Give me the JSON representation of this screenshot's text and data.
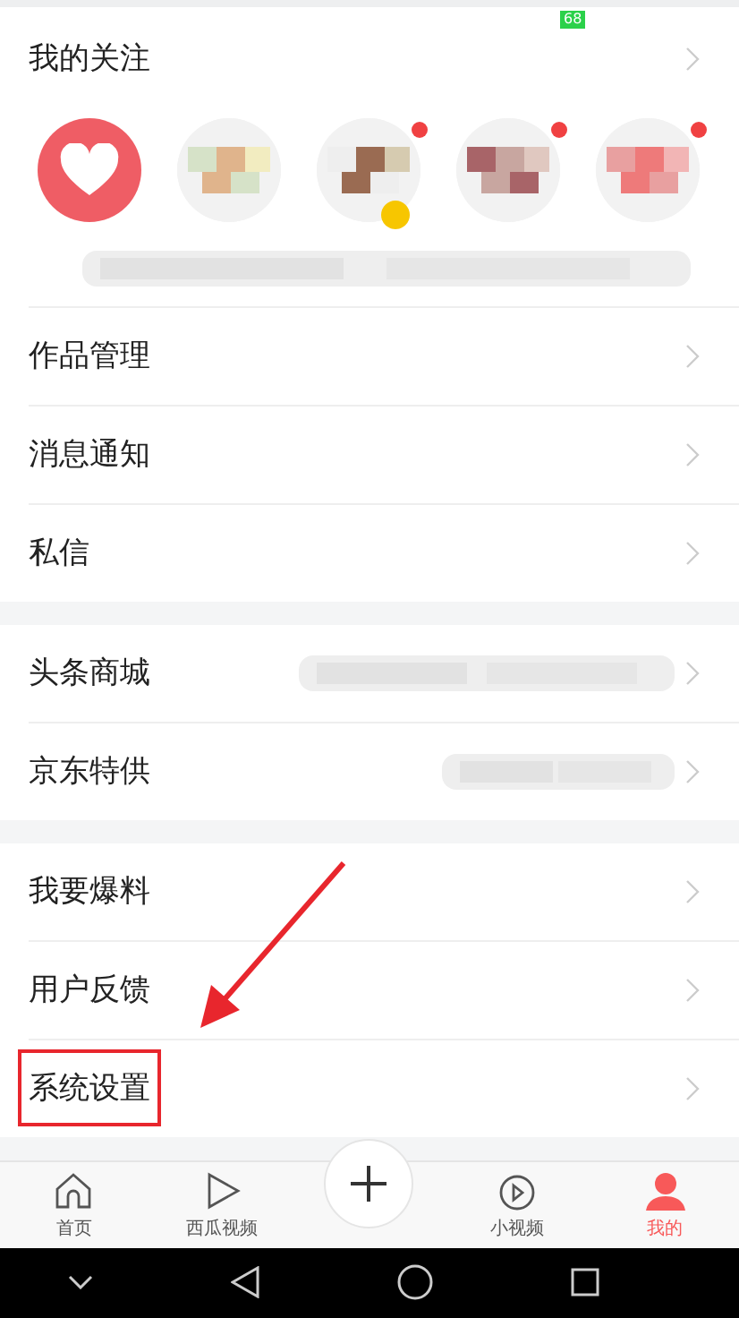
{
  "status_bar": {
    "battery": "68"
  },
  "following": {
    "title": "我的关注",
    "avatars": [
      {
        "kind": "heart",
        "dot": false,
        "verified": false
      },
      {
        "kind": "picture",
        "dot": false,
        "verified": false
      },
      {
        "kind": "picture",
        "dot": true,
        "verified": true
      },
      {
        "kind": "picture",
        "dot": true,
        "verified": false
      },
      {
        "kind": "picture",
        "dot": true,
        "verified": false
      }
    ]
  },
  "menu_groups": [
    {
      "items": [
        {
          "label": "作品管理",
          "highlighted": false
        },
        {
          "label": "消息通知",
          "highlighted": false
        },
        {
          "label": "私信",
          "highlighted": false
        }
      ]
    },
    {
      "items": [
        {
          "label": "头条商城",
          "highlighted": false,
          "blurred": true
        },
        {
          "label": "京东特供",
          "highlighted": false,
          "blurred": true
        }
      ]
    },
    {
      "items": [
        {
          "label": "我要爆料",
          "highlighted": false
        },
        {
          "label": "用户反馈",
          "highlighted": false
        },
        {
          "label": "系统设置",
          "highlighted": true
        }
      ]
    }
  ],
  "tab_bar": [
    {
      "kind": "home",
      "label": "首页",
      "selected": false
    },
    {
      "kind": "video",
      "label": "西瓜视频",
      "selected": false
    },
    {
      "kind": "add",
      "selected": false
    },
    {
      "kind": "short",
      "label": "小视频",
      "selected": false
    },
    {
      "kind": "me",
      "label": "我的",
      "selected": true
    }
  ]
}
